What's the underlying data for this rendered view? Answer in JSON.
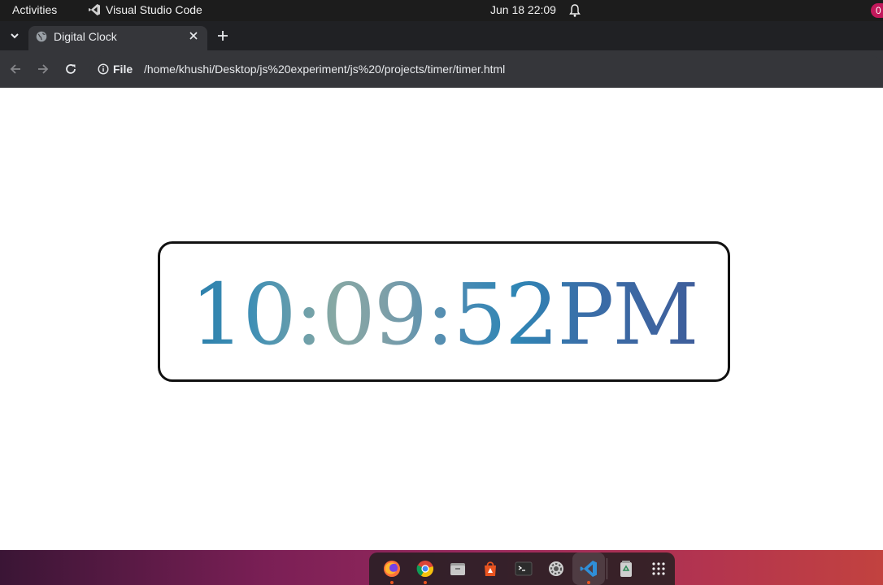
{
  "topbar": {
    "activities": "Activities",
    "app_name": "Visual Studio Code",
    "clock": "Jun 18  22:09",
    "record_badge": "0"
  },
  "browser": {
    "tab_title": "Digital Clock",
    "scheme": "File",
    "url": "/home/khushi/Desktop/js%20experiment/js%20/projects/timer/timer.html"
  },
  "page": {
    "clock_text": "10:09:52PM"
  },
  "dock": {
    "items": [
      "firefox",
      "chrome",
      "files",
      "app-center",
      "terminal",
      "settings",
      "vscode",
      "trash",
      "show-apps"
    ]
  },
  "colors": {
    "clock_gradient_start": "#2b7fab",
    "clock_gradient_mid": "#86a8a4",
    "clock_gradient_end": "#3f5e9b",
    "accent_dot": "#e95420"
  }
}
